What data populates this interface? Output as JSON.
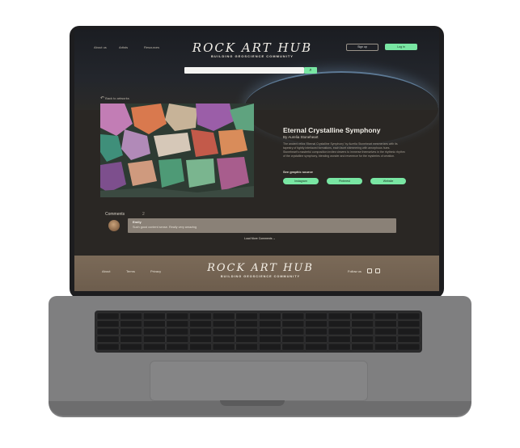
{
  "site": {
    "logo": "ROCK ART HUB",
    "tagline": "BUILDING GEOSCIENCE COMMUNITY",
    "nav": [
      "About us",
      "Artists",
      "Resources"
    ],
    "signup_label": "Sign up",
    "login_label": "Log in",
    "search_placeholder": "",
    "search_icon": "search-icon",
    "accent_color": "#79e6a3"
  },
  "back": {
    "label": "Back to artworks"
  },
  "artwork": {
    "title": "Eternal Crystalline Symphony",
    "author": "By Aurelia Stoneheart",
    "description": "The ancient relics 'Eternal Crystalline Symphony' by Aurelia Stoneheart mesmerizes with its tapestry of tightly interlaced formations, each facet shimmering with amorphous hues. Stoneheart's masterful composition invites viewers to immerse themselves in the rhythmic rhythm of the crystalline symphony, blending wonder and reverence for the mysteries of creation.",
    "see_more_label": "See graphic source",
    "source_links": [
      "Instagram",
      "Pinterest",
      "Website"
    ]
  },
  "comments": {
    "heading": "Comments",
    "count": "2",
    "items": [
      {
        "user": "Emily",
        "text": "Such good content sense. Really very amazing"
      }
    ],
    "load_more_label": "Load More Comments"
  },
  "footer": {
    "logo": "ROCK ART HUB",
    "tagline": "BUILDING GEOSCIENCE COMMUNITY",
    "nav": [
      "About",
      "Terms",
      "Privacy"
    ],
    "follow_label": "Follow us",
    "social_icons": [
      "instagram-icon",
      "linkedin-icon"
    ]
  }
}
